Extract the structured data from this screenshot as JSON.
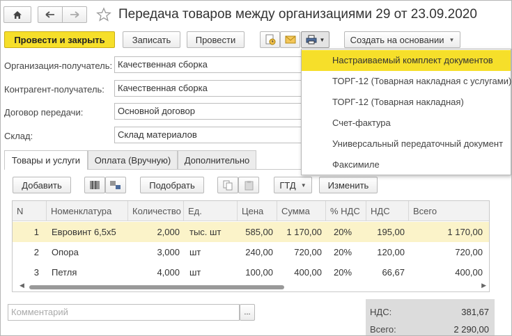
{
  "title": "Передача товаров между организациями 29 от 23.09.2020",
  "toolbar": {
    "post_close": "Провести и закрыть",
    "save": "Записать",
    "post": "Провести",
    "create_based": "Создать на основании"
  },
  "fields": [
    {
      "label": "Организация-получатель:",
      "value": "Качественная сборка"
    },
    {
      "label": "Контрагент-получатель:",
      "value": "Качественная сборка"
    },
    {
      "label": "Договор передачи:",
      "value": "Основной договор"
    },
    {
      "label": "Склад:",
      "value": "Склад материалов"
    }
  ],
  "tabs": [
    "Товары и услуги",
    "Оплата (Вручную)",
    "Дополнительно"
  ],
  "table_toolbar": {
    "add": "Добавить",
    "pick": "Подобрать",
    "gtd": "ГТД",
    "change": "Изменить"
  },
  "table": {
    "columns": [
      "N",
      "Номенклатура",
      "Количество",
      "Ед.",
      "Цена",
      "Сумма",
      "% НДС",
      "НДС",
      "Всего"
    ],
    "rows": [
      [
        "1",
        "Евровинт 6,5х5",
        "2,000",
        "тыс. шт",
        "585,00",
        "1 170,00",
        "20%",
        "195,00",
        "1 170,00"
      ],
      [
        "2",
        "Опора",
        "3,000",
        "шт",
        "240,00",
        "720,00",
        "20%",
        "120,00",
        "720,00"
      ],
      [
        "3",
        "Петля",
        "4,000",
        "шт",
        "100,00",
        "400,00",
        "20%",
        "66,67",
        "400,00"
      ]
    ]
  },
  "print_menu": {
    "items": [
      "Настраиваемый комплект документов",
      "ТОРГ-12 (Товарная накладная с услугами)",
      "ТОРГ-12 (Товарная накладная)",
      "Счет-фактура",
      "Универсальный передаточный документ",
      "Факсимиле"
    ]
  },
  "comment": {
    "placeholder": "Комментарий",
    "button": "..."
  },
  "totals": {
    "vat_label": "НДС:",
    "vat_value": "381,67",
    "total_label": "Всего:",
    "total_value": "2 290,00"
  },
  "colors": {
    "accent": "#f6df2a",
    "selected_row": "#fbf3c9",
    "window_border": "#b5b5b5"
  }
}
